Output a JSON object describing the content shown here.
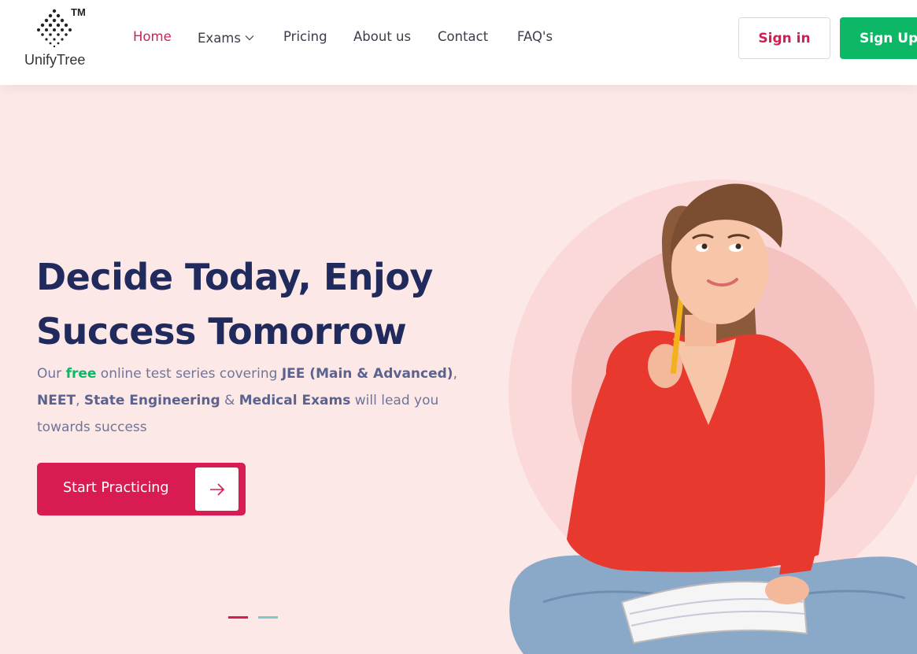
{
  "brand": {
    "name": "UnifyTree",
    "trademark": "TM"
  },
  "nav": {
    "items": [
      {
        "label": "Home",
        "active": true
      },
      {
        "label": "Exams",
        "has_dropdown": true
      },
      {
        "label": "Pricing"
      },
      {
        "label": "About us"
      },
      {
        "label": "Contact"
      },
      {
        "label": "FAQ's"
      }
    ]
  },
  "auth": {
    "signin_label": "Sign in",
    "signup_label": "Sign Up"
  },
  "hero": {
    "title_line1": "Decide Today, Enjoy",
    "title_line2": "Success Tomorrow",
    "desc": {
      "t1": "Our ",
      "free": "free",
      "t2": " online test series covering ",
      "jee": "JEE (Main & Advanced)",
      "t3": ",",
      "neet": "NEET",
      "t4": ", ",
      "state": "State Engineering",
      "t5": " & ",
      "medical": "Medical Exams",
      "t6": " will lead you towards success"
    },
    "cta_label": "Start Practicing",
    "cta_icon": "arrow-right-icon"
  },
  "carousel": {
    "slides": 2,
    "active_index": 0
  },
  "colors": {
    "accent": "#d81b50",
    "success": "#0cb866",
    "heading": "#202a5c",
    "hero_bg": "#fde8e8",
    "dot_active": "#d81b50",
    "dot_inactive": "#7ec9c4"
  }
}
